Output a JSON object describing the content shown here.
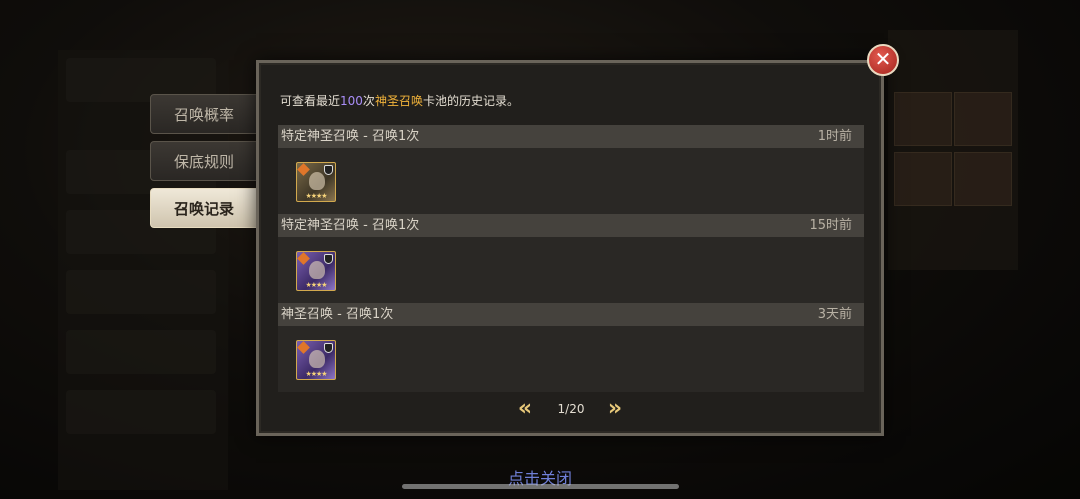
{
  "tabs": [
    {
      "label": "召唤概率",
      "active": false
    },
    {
      "label": "保底规则",
      "active": false
    },
    {
      "label": "召唤记录",
      "active": true
    }
  ],
  "description": {
    "prefix": "可查看最近",
    "count": "100",
    "middle": "次",
    "pool": "神圣召唤",
    "suffix": "卡池的历史记录。"
  },
  "records": [
    {
      "title": "特定神圣召唤 - 召唤1次",
      "time": "1时前",
      "rarity_color": "gold",
      "stars": "★★★★"
    },
    {
      "title": "特定神圣召唤 - 召唤1次",
      "time": "15时前",
      "rarity_color": "purple",
      "stars": "★★★★"
    },
    {
      "title": "神圣召唤 - 召唤1次",
      "time": "3天前",
      "rarity_color": "purple",
      "stars": "★★★★"
    }
  ],
  "pager": {
    "prev_icon": "double-chevron-left-icon",
    "page": "1/20",
    "next_icon": "double-chevron-right-icon"
  },
  "close_icon": "close-icon",
  "close_glyph": "✕",
  "tap_to_close": "点击关闭",
  "colors": {
    "accent_gold": "#f0b23a",
    "count_purple": "#a98df7",
    "close_red": "#c9352c"
  }
}
